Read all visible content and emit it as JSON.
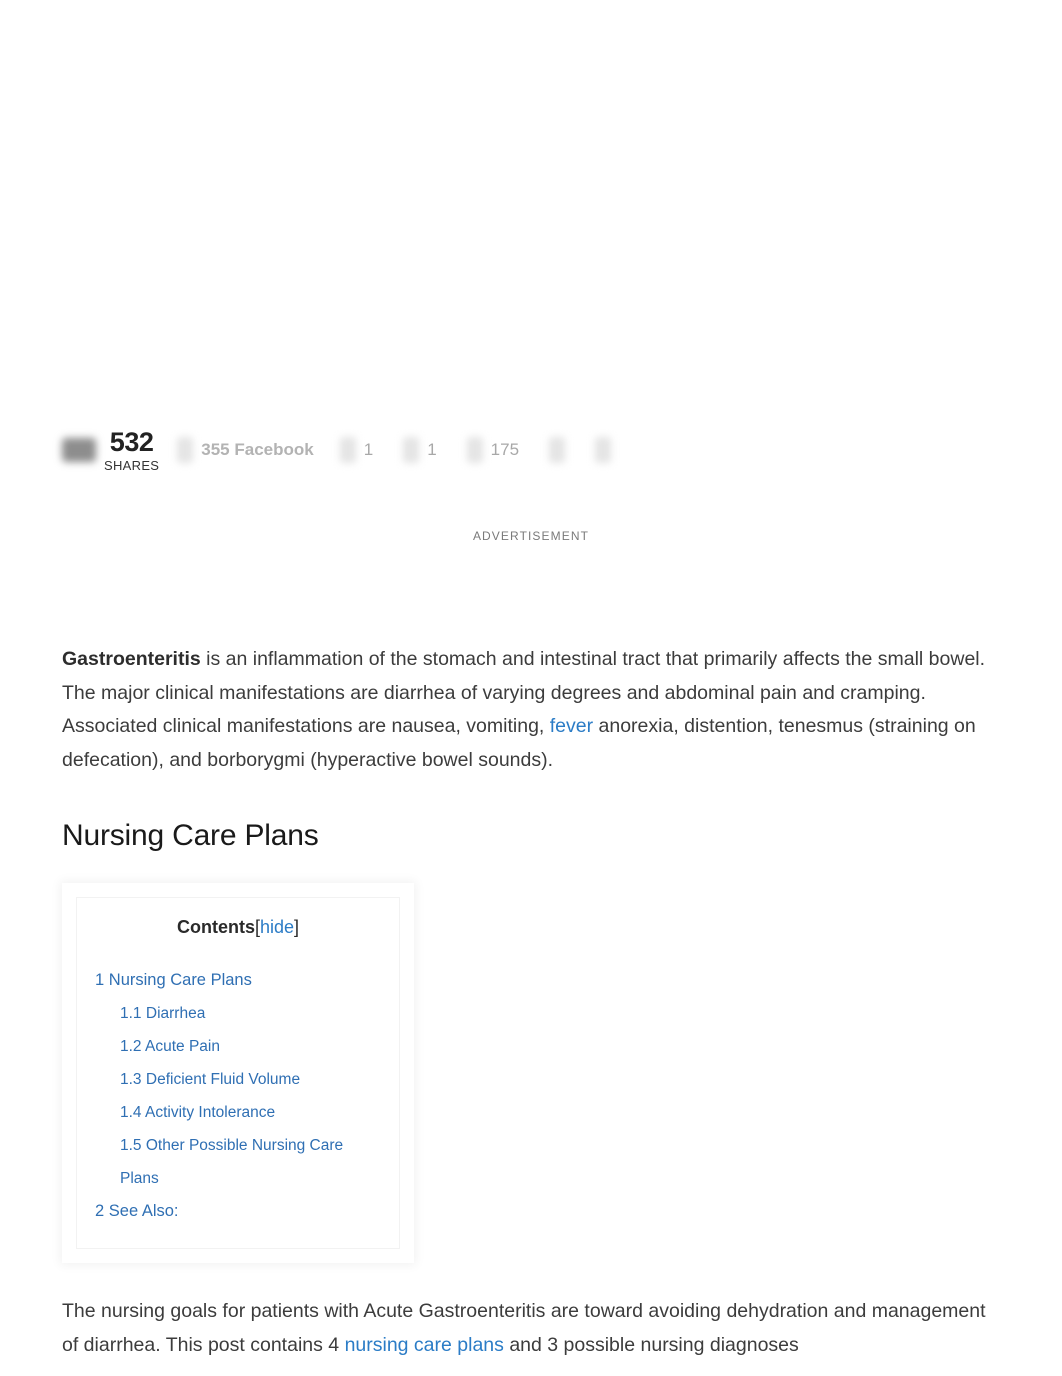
{
  "share_bar": {
    "total_count": "532",
    "total_label": "SHARES",
    "networks": [
      {
        "icon": "facebook-share-icon",
        "label": "355 Facebook",
        "is_number": false
      },
      {
        "icon": "twitter-share-icon",
        "label": "1",
        "is_number": true
      },
      {
        "icon": "pinterest-share-icon",
        "label": "1",
        "is_number": true
      },
      {
        "icon": "linkedin-share-icon",
        "label": "175",
        "is_number": true
      },
      {
        "icon": "email-share-icon",
        "label": "",
        "is_number": false
      },
      {
        "icon": "more-share-icon",
        "label": "",
        "is_number": false
      }
    ]
  },
  "advertisement": {
    "label": "ADVERTISEMENT"
  },
  "intro": {
    "lead_term": "Gastroenteritis",
    "part1": " is an inflammation of the stomach and intestinal tract that primarily affects the small bowel. The major clinical manifestations are diarrhea of varying degrees and abdominal pain and cramping. Associated clinical manifestations are nausea, vomiting, ",
    "link_text": "fever",
    "part2": " anorexia, distention, tenesmus (straining on defecation), and borborygmi (hyperactive bowel sounds)."
  },
  "section": {
    "heading": "Nursing Care Plans"
  },
  "toc": {
    "title": "Contents",
    "bracket_open": "[",
    "toggle_label": "hide",
    "bracket_close": "]",
    "items": [
      {
        "number": "1",
        "label": "Nursing Care Plans",
        "level": 1
      },
      {
        "number": "1.1",
        "label": "Diarrhea",
        "level": 2
      },
      {
        "number": "1.2",
        "label": "Acute Pain",
        "level": 2
      },
      {
        "number": "1.3",
        "label": "Deficient Fluid Volume",
        "level": 2
      },
      {
        "number": "1.4",
        "label": "Activity Intolerance",
        "level": 2
      },
      {
        "number": "1.5",
        "label": "Other Possible Nursing Care Plans",
        "level": 2
      },
      {
        "number": "2",
        "label": "See Also:",
        "level": 1
      }
    ]
  },
  "goals": {
    "part1": "The nursing goals for patients with Acute Gastroenteritis are toward avoiding dehydration and management of diarrhea. This post contains 4 ",
    "link_text": "nursing care plans",
    "part2": " and 3 possible nursing diagnoses"
  },
  "colors": {
    "link_blue": "#2b7cc6",
    "toc_link_blue": "#2f6fb3",
    "body_text": "#3c3c3c",
    "muted_gray": "#b3b3b3"
  }
}
